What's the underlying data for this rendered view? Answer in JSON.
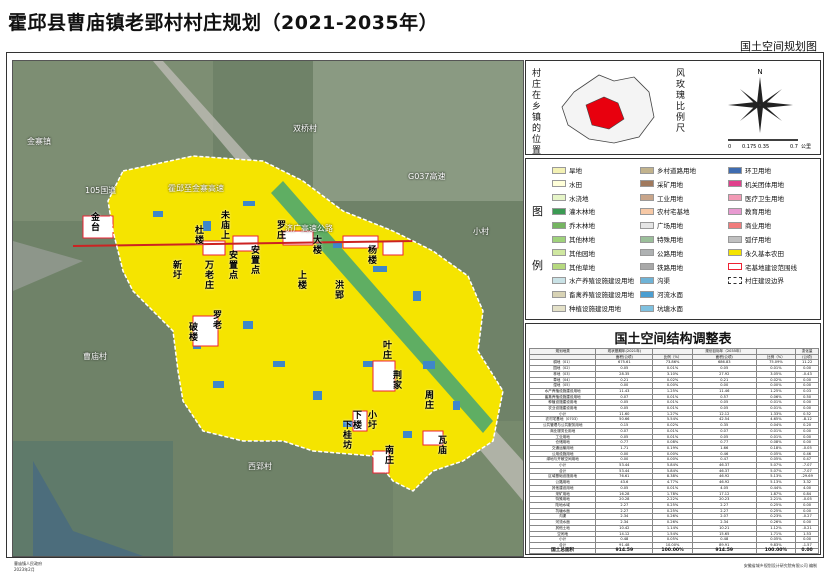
{
  "title": "霍邱县曹庙镇老郢村村庄规划（2021-2035年）",
  "subtitle": "国土空间规划图",
  "map": {
    "road_labels": [
      "105国道",
      "霍邱至金寨高速",
      "济广高速公路",
      "G037高速",
      "双桥村",
      "金寨镇",
      "曹庙村",
      "西郢村",
      "小村"
    ],
    "village_labels": [
      "金台",
      "杜楼",
      "未庙上",
      "安置点",
      "安置点",
      "罗庄",
      "大楼",
      "杨楼",
      "上楼",
      "洪郢",
      "新圩",
      "万老庄",
      "罗老",
      "破楼",
      "叶庄",
      "下楼",
      "荆家",
      "下桂坊",
      "小圩",
      "南庄",
      "瓦庙",
      "周庄"
    ]
  },
  "location": {
    "label_vertical": "村庄在乡镇的位置",
    "rose_label_vertical": "风玫瑰比例尺",
    "north": "N",
    "scale": [
      "0",
      "0.175",
      "0.35",
      "0.7",
      "公里"
    ]
  },
  "legend": {
    "heading_1": "图",
    "heading_2": "例",
    "items": [
      {
        "label": "旱地",
        "color": "#f3f1b4"
      },
      {
        "label": "水田",
        "color": "#ffffd9"
      },
      {
        "label": "水浇地",
        "color": "#e6f5c8"
      },
      {
        "label": "灌木林地",
        "color": "#3b9a53"
      },
      {
        "label": "乔木林地",
        "color": "#75b561"
      },
      {
        "label": "其他林地",
        "color": "#9fd27b"
      },
      {
        "label": "其他园地",
        "color": "#cfe7a0"
      },
      {
        "label": "其他草地",
        "color": "#b6d97f"
      },
      {
        "label": "水产养殖设施建设用地",
        "color": "#c9e2e6"
      },
      {
        "label": "畜禽养殖设施建设用地",
        "color": "#d8d3b5"
      },
      {
        "label": "种植设施建设用地",
        "color": "#e4e1c8"
      },
      {
        "label": "乡村道路用地",
        "color": "#c2b38d"
      },
      {
        "label": "采矿用地",
        "color": "#a0795d"
      },
      {
        "label": "工业用地",
        "color": "#c8a58a"
      },
      {
        "label": "农村宅基地",
        "color": "#f7c9a6"
      },
      {
        "label": "广场用地",
        "color": "#e5e5e5"
      },
      {
        "label": "特殊用地",
        "color": "#9bbf9a"
      },
      {
        "label": "公路用地",
        "color": "#aeb1b2"
      },
      {
        "label": "铁路用地",
        "color": "#a8a8a8"
      },
      {
        "label": "沟渠",
        "color": "#6fb3d6"
      },
      {
        "label": "河流水面",
        "color": "#4b9ed1"
      },
      {
        "label": "坑塘水面",
        "color": "#7fc1e0"
      },
      {
        "label": "环卫用地",
        "color": "#3f6cb0"
      },
      {
        "label": "机关团体用地",
        "color": "#e0408c"
      },
      {
        "label": "医疗卫生用地",
        "color": "#f29ab5"
      },
      {
        "label": "教育用地",
        "color": "#e89ad1"
      },
      {
        "label": "商业用地",
        "color": "#f07c7c"
      },
      {
        "label": "弧仔用地",
        "color": "#c0c0c0"
      },
      {
        "label": "永久基本农田",
        "color": "#f5e400"
      },
      {
        "label": "宅基地建设范围线",
        "color": "#ffffff"
      },
      {
        "label": "村庄建设边界",
        "color": "#ffffff"
      }
    ]
  },
  "table": {
    "title": "国土空间结构调整表",
    "header": [
      "规划地类",
      "现状基期年(2021年)",
      "",
      "规划目标年（2035年）",
      "",
      "变化量"
    ],
    "subheader": [
      "",
      "面积(公顷)",
      "比例（%）",
      "面积(公顷)",
      "比例（%）",
      "(公顷)"
    ],
    "rows": [
      [
        "耕地（01）",
        "675.61",
        "73.86%",
        "686.83",
        "75.09%",
        "11.22"
      ],
      [
        "园地（02）",
        "0.05",
        "0.01%",
        "0.05",
        "0.01%",
        "0.00"
      ],
      [
        "林地（03）",
        "28.35",
        "3.10%",
        "27.92",
        "3.05%",
        "-0.43"
      ],
      [
        "草地（04）",
        "0.21",
        "0.02%",
        "0.21",
        "0.02%",
        "0.00"
      ],
      [
        "湿地（05）",
        "0.00",
        "0.00%",
        "0.00",
        "0.00%",
        "0.00"
      ],
      [
        "水产养殖设施建设用地",
        "11.43",
        "1.25%",
        "11.46",
        "1.25%",
        "0.03"
      ],
      [
        "畜禽养殖设施建设用地",
        "0.07",
        "0.01%",
        "0.57",
        "0.06%",
        "0.50"
      ],
      [
        "种植设施建设用地",
        "0.05",
        "0.01%",
        "0.05",
        "0.01%",
        "0.00"
      ],
      [
        "农业设施建设用地",
        "0.05",
        "0.01%",
        "0.05",
        "0.01%",
        "0.00"
      ],
      [
        "小计",
        "11.60",
        "1.27%",
        "12.12",
        "1.33%",
        "0.52"
      ],
      [
        "农村宅基地（0703）",
        "50.66",
        "5.54%",
        "42.54",
        "4.65%",
        "-8.12"
      ],
      [
        "公共管理与公共服务用地",
        "0.15",
        "0.02%",
        "0.35",
        "0.04%",
        "0.20"
      ],
      [
        "商业服务业用地",
        "0.07",
        "0.01%",
        "0.07",
        "0.01%",
        "0.00"
      ],
      [
        "工业用地",
        "0.05",
        "0.01%",
        "0.05",
        "0.01%",
        "0.00"
      ],
      [
        "仓储用地",
        "0.77",
        "0.08%",
        "0.77",
        "0.08%",
        "0.00"
      ],
      [
        "交通运输用地",
        "1.71",
        "0.19%",
        "1.66",
        "0.18%",
        "-0.05"
      ],
      [
        "公用设施用地",
        "0.00",
        "0.00%",
        "0.46",
        "0.05%",
        "0.46"
      ],
      [
        "绿地与开敞空间用地",
        "0.00",
        "0.00%",
        "0.47",
        "0.05%",
        "0.47"
      ],
      [
        "小计",
        "53.44",
        "5.84%",
        "46.37",
        "5.07%",
        "-7.07"
      ],
      [
        "合计",
        "53.44",
        "5.84%",
        "46.37",
        "5.07%",
        "-7.07"
      ],
      [
        "区域基础设施用地",
        "76.61",
        "8.38%",
        "46.92",
        "5.13%",
        "-29.69"
      ],
      [
        "公路用地",
        "43.6",
        "4.77%",
        "46.92",
        "5.13%",
        "3.32"
      ],
      [
        "其他建设用地",
        "0.05",
        "0.01%",
        "4.05",
        "0.44%",
        "4.00"
      ],
      [
        "采矿用地",
        "16.28",
        "1.78%",
        "17.12",
        "1.87%",
        "0.84"
      ],
      [
        "特殊用地",
        "20.28",
        "2.22%",
        "20.23",
        "2.21%",
        "-0.05"
      ],
      [
        "陆地水域",
        "2.27",
        "0.25%",
        "2.27",
        "0.25%",
        "0.00"
      ],
      [
        "坑塘水面",
        "2.27",
        "0.25%",
        "2.27",
        "0.25%",
        "0.00"
      ],
      [
        "沟渠",
        "2.34",
        "0.26%",
        "2.07",
        "0.23%",
        "-0.27"
      ],
      [
        "河流水面",
        "2.34",
        "0.26%",
        "2.34",
        "0.26%",
        "0.00"
      ],
      [
        "其他土地",
        "10.42",
        "1.14%",
        "10.21",
        "1.12%",
        "-0.21"
      ],
      [
        "空闲地",
        "14.12",
        "1.54%",
        "15.65",
        "1.71%",
        "1.53"
      ],
      [
        "小计",
        "0.48",
        "0.05%",
        "0.48",
        "0.05%",
        "0.00"
      ],
      [
        "合计",
        "91.48",
        "10.00%",
        "89.91",
        "9.83%",
        "-1.57"
      ]
    ],
    "total": [
      "国土总面积",
      "914.59",
      "100.00%",
      "914.59",
      "100.00%",
      "0.00"
    ]
  },
  "footer_left": "曹庙镇人民政府",
  "footer_date": "2023年2月",
  "footer_right": "安徽省城乡规划设计研究院有限公司 编制"
}
